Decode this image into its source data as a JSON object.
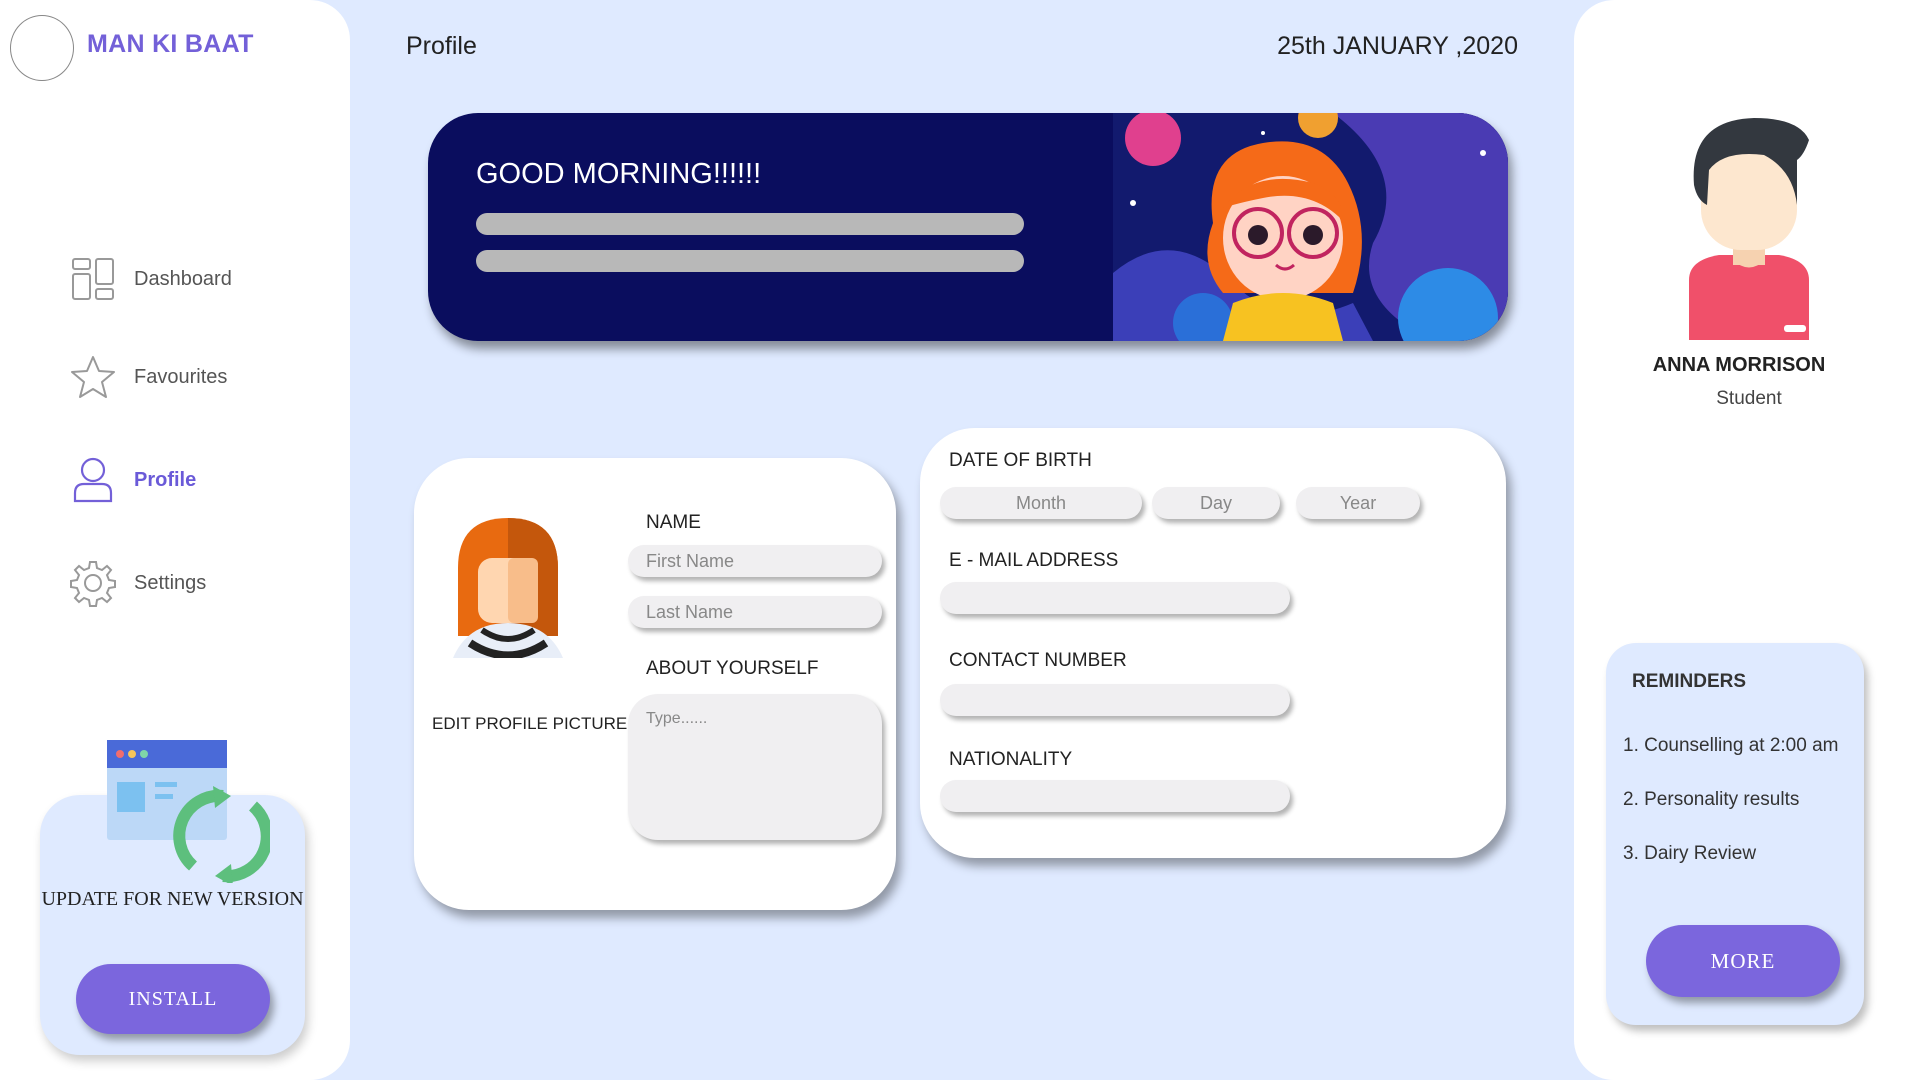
{
  "app": {
    "brand": "MAN KI BAAT"
  },
  "header": {
    "title": "Profile",
    "date": "25th JANUARY ,2020"
  },
  "sidebar": {
    "items": [
      {
        "label": "Dashboard",
        "icon": "dashboard-icon",
        "active": false
      },
      {
        "label": "Favourites",
        "icon": "star-icon",
        "active": false
      },
      {
        "label": "Profile",
        "icon": "user-icon",
        "active": true
      },
      {
        "label": "Settings",
        "icon": "gear-icon",
        "active": false
      }
    ],
    "update": {
      "text": "UPDATE FOR NEW VERSION",
      "button": "INSTALL"
    }
  },
  "banner": {
    "greeting": "GOOD MORNING!!!!!!"
  },
  "profile_form": {
    "edit_picture_label": "EDIT PROFILE PICTURE",
    "name_label": "NAME",
    "first_name_placeholder": "First Name",
    "last_name_placeholder": "Last Name",
    "about_label": "ABOUT YOURSELF",
    "about_placeholder": "Type......"
  },
  "details_form": {
    "dob_label": "DATE OF BIRTH",
    "month": "Month",
    "day": "Day",
    "year": "Year",
    "email_label": "E - MAIL ADDRESS",
    "contact_label": "CONTACT NUMBER",
    "nationality_label": "NATIONALITY"
  },
  "user": {
    "name": "ANNA MORRISON",
    "role": "Student"
  },
  "reminders": {
    "title": "REMINDERS",
    "items": [
      "1.  Counselling at 2:00 am",
      "2.  Personality results",
      "3. Dairy Review"
    ],
    "button": "MORE"
  },
  "colors": {
    "accent": "#7b66dd",
    "background": "#dfeaff",
    "banner": "#0a0d5e"
  }
}
